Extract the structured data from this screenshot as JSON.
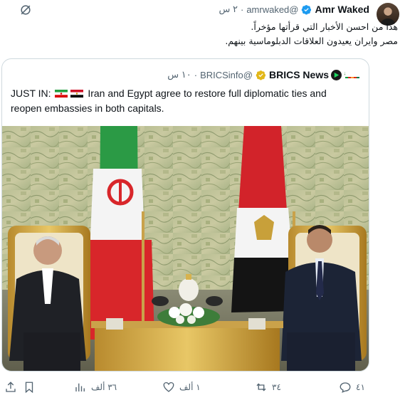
{
  "tweet": {
    "author_name": "Amr Waked",
    "handle": "@amrwaked",
    "separator": "·",
    "time": "٢ س",
    "text_line1": "هذا من احسن الأخبار التي قرأتها مؤخراً.",
    "text_line2": "مصر وايران يعيدون العلاقات الدبلوماسية بينهم."
  },
  "quoted": {
    "logo_text": "BRICS",
    "author_name": "BRICS News",
    "handle": "@BRICSinfo",
    "separator": "·",
    "time": "١٠ س",
    "text_prefix": "JUST IN:",
    "text_body": "Iran and Egypt agree to restore full diplomatic ties and reopen embassies in both capitals."
  },
  "actions": {
    "replies": "٤١",
    "retweets": "٣٤",
    "likes": "١ ألف",
    "views": "٣٦ ألف"
  },
  "colors": {
    "verified_blue": "#1d9bf0",
    "verified_gold": "#e2b719",
    "muted": "#536471"
  }
}
